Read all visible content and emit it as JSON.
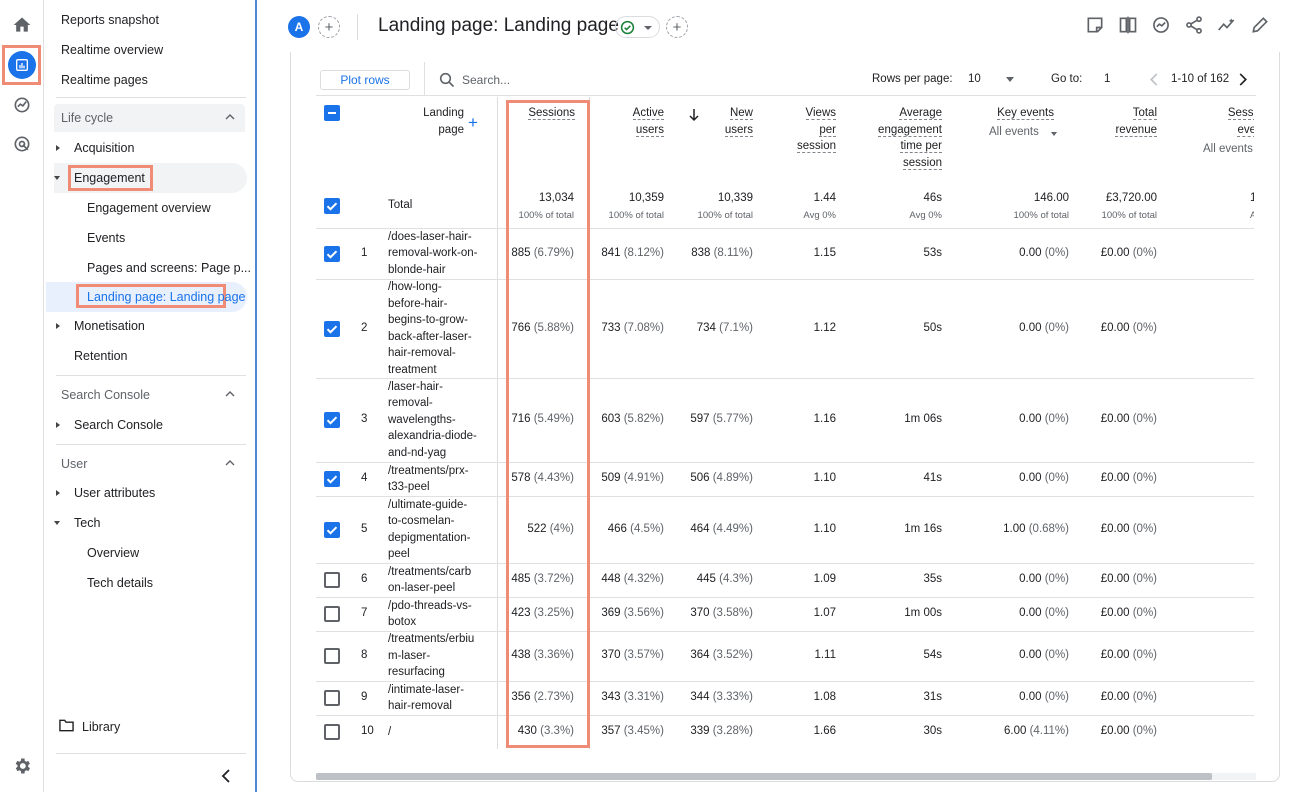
{
  "rail": {
    "items": [
      "home-icon",
      "reports-icon",
      "explore-icon",
      "advertising-icon",
      "settings-icon"
    ]
  },
  "sidebar": {
    "top_items": [
      "Reports snapshot",
      "Realtime overview",
      "Realtime pages"
    ],
    "lifecycle": {
      "title": "Life cycle",
      "acquisition": "Acquisition",
      "engagement": "Engagement",
      "engagement_children": [
        "Engagement overview",
        "Events",
        "Pages and screens: Page p...",
        "Landing page: Landing page"
      ],
      "monetisation": "Monetisation",
      "retention": "Retention"
    },
    "search_console": {
      "title": "Search Console",
      "item": "Search Console"
    },
    "user": {
      "title": "User",
      "attributes": "User attributes",
      "tech": "Tech",
      "tech_children": [
        "Overview",
        "Tech details"
      ]
    },
    "library": "Library"
  },
  "header": {
    "avatar_letter": "A",
    "title": "Landing page: Landing page",
    "icons": [
      "customize-report-icon",
      "compare-icon",
      "insights-icon",
      "share-icon",
      "trend-icon",
      "edit-icon"
    ]
  },
  "toolbar": {
    "plot_rows": "Plot rows",
    "search_placeholder": "Search...",
    "rows_per_page_label": "Rows per page:",
    "rows_per_page_value": "10",
    "goto_label": "Go to:",
    "goto_value": "1",
    "range": "1-10 of 162"
  },
  "table": {
    "dim_header": [
      "Landing",
      "page"
    ],
    "headers": {
      "sessions": "Sessions",
      "active_users": [
        "Active",
        "users"
      ],
      "new_users": [
        "New",
        "users"
      ],
      "views": [
        "Views",
        "per",
        "session"
      ],
      "avg_eng": [
        "Average",
        "engagement",
        "time per",
        "session"
      ],
      "key_events": "Key events",
      "key_events_sub": "All events",
      "revenue": [
        "Total",
        "revenue"
      ],
      "session_key": [
        "Sessi",
        "eve"
      ],
      "session_key_sub": "All events"
    },
    "total": {
      "label": "Total",
      "sessions": "13,034",
      "sessions_sub": "100% of total",
      "active_users": "10,359",
      "active_users_sub": "100% of total",
      "new_users": "10,339",
      "new_users_sub": "100% of total",
      "views": "1.44",
      "views_sub": "Avg 0%",
      "avg_eng": "46s",
      "avg_eng_sub": "Avg 0%",
      "key_events": "146.00",
      "key_events_sub": "100% of total",
      "revenue": "£3,720.00",
      "revenue_sub": "100% of total",
      "session_key": "1",
      "session_key_sub": "A"
    },
    "rows": [
      {
        "n": "1",
        "page": "/does-laser-hair-removal-work-on-blonde-hair",
        "lines": [
          "/does-laser-hair-",
          "removal-work-on-",
          "blonde-hair"
        ],
        "sessions": "885",
        "sessions_pct": "(6.79%)",
        "active": "841",
        "active_pct": "(8.12%)",
        "new": "838",
        "new_pct": "(8.11%)",
        "views": "1.15",
        "eng": "53s",
        "key": "0.00",
        "key_pct": "(0%)",
        "rev": "£0.00",
        "rev_pct": "(0%)",
        "checked": true
      },
      {
        "n": "2",
        "page": "/how-long-before-hair-begins-to-grow-back-after-laser-hair-removal-treatment",
        "lines": [
          "/how-long-",
          "before-hair-",
          "begins-to-grow-",
          "back-after-laser-",
          "hair-removal-",
          "treatment"
        ],
        "sessions": "766",
        "sessions_pct": "(5.88%)",
        "active": "733",
        "active_pct": "(7.08%)",
        "new": "734",
        "new_pct": "(7.1%)",
        "views": "1.12",
        "eng": "50s",
        "key": "0.00",
        "key_pct": "(0%)",
        "rev": "£0.00",
        "rev_pct": "(0%)",
        "checked": true
      },
      {
        "n": "3",
        "page": "/laser-hair-removal-wavelengths-alexandria-diode-and-nd-yag",
        "lines": [
          "/laser-hair-",
          "removal-",
          "wavelengths-",
          "alexandria-diode-",
          "and-nd-yag"
        ],
        "sessions": "716",
        "sessions_pct": "(5.49%)",
        "active": "603",
        "active_pct": "(5.82%)",
        "new": "597",
        "new_pct": "(5.77%)",
        "views": "1.16",
        "eng": "1m 06s",
        "key": "0.00",
        "key_pct": "(0%)",
        "rev": "£0.00",
        "rev_pct": "(0%)",
        "checked": true
      },
      {
        "n": "4",
        "page": "/treatments/prx-t33-peel",
        "lines": [
          "/treatments/prx-",
          "t33-peel"
        ],
        "sessions": "578",
        "sessions_pct": "(4.43%)",
        "active": "509",
        "active_pct": "(4.91%)",
        "new": "506",
        "new_pct": "(4.89%)",
        "views": "1.10",
        "eng": "41s",
        "key": "0.00",
        "key_pct": "(0%)",
        "rev": "£0.00",
        "rev_pct": "(0%)",
        "checked": true
      },
      {
        "n": "5",
        "page": "/ultimate-guide-to-cosmelan-depigmentation-peel",
        "lines": [
          "/ultimate-guide-",
          "to-cosmelan-",
          "depigmentation-",
          "peel"
        ],
        "sessions": "522",
        "sessions_pct": "(4%)",
        "active": "466",
        "active_pct": "(4.5%)",
        "new": "464",
        "new_pct": "(4.49%)",
        "views": "1.10",
        "eng": "1m 16s",
        "key": "1.00",
        "key_pct": "(0.68%)",
        "rev": "£0.00",
        "rev_pct": "(0%)",
        "checked": true
      },
      {
        "n": "6",
        "page": "/treatments/carbon-laser-peel",
        "lines": [
          "/treatments/carb",
          "on-laser-peel"
        ],
        "sessions": "485",
        "sessions_pct": "(3.72%)",
        "active": "448",
        "active_pct": "(4.32%)",
        "new": "445",
        "new_pct": "(4.3%)",
        "views": "1.09",
        "eng": "35s",
        "key": "0.00",
        "key_pct": "(0%)",
        "rev": "£0.00",
        "rev_pct": "(0%)",
        "checked": false
      },
      {
        "n": "7",
        "page": "/pdo-threads-vs-botox",
        "lines": [
          "/pdo-threads-vs-",
          "botox"
        ],
        "sessions": "423",
        "sessions_pct": "(3.25%)",
        "active": "369",
        "active_pct": "(3.56%)",
        "new": "370",
        "new_pct": "(3.58%)",
        "views": "1.07",
        "eng": "1m 00s",
        "key": "0.00",
        "key_pct": "(0%)",
        "rev": "£0.00",
        "rev_pct": "(0%)",
        "checked": false
      },
      {
        "n": "8",
        "page": "/treatments/erbium-laser-resurfacing",
        "lines": [
          "/treatments/erbiu",
          "m-laser-",
          "resurfacing"
        ],
        "sessions": "438",
        "sessions_pct": "(3.36%)",
        "active": "370",
        "active_pct": "(3.57%)",
        "new": "364",
        "new_pct": "(3.52%)",
        "views": "1.11",
        "eng": "54s",
        "key": "0.00",
        "key_pct": "(0%)",
        "rev": "£0.00",
        "rev_pct": "(0%)",
        "checked": false
      },
      {
        "n": "9",
        "page": "/intimate-laser-hair-removal",
        "lines": [
          "/intimate-laser-",
          "hair-removal"
        ],
        "sessions": "356",
        "sessions_pct": "(2.73%)",
        "active": "343",
        "active_pct": "(3.31%)",
        "new": "344",
        "new_pct": "(3.33%)",
        "views": "1.08",
        "eng": "31s",
        "key": "0.00",
        "key_pct": "(0%)",
        "rev": "£0.00",
        "rev_pct": "(0%)",
        "checked": false
      },
      {
        "n": "10",
        "page": "/",
        "lines": [
          "/"
        ],
        "sessions": "430",
        "sessions_pct": "(3.3%)",
        "active": "357",
        "active_pct": "(3.45%)",
        "new": "339",
        "new_pct": "(3.28%)",
        "views": "1.66",
        "eng": "30s",
        "key": "6.00",
        "key_pct": "(4.11%)",
        "rev": "£0.00",
        "rev_pct": "(0%)",
        "checked": false
      }
    ]
  },
  "colors": {
    "accent": "#1a73e8",
    "highlight": "#f08c76",
    "selected_bg": "#e8f0fe"
  }
}
